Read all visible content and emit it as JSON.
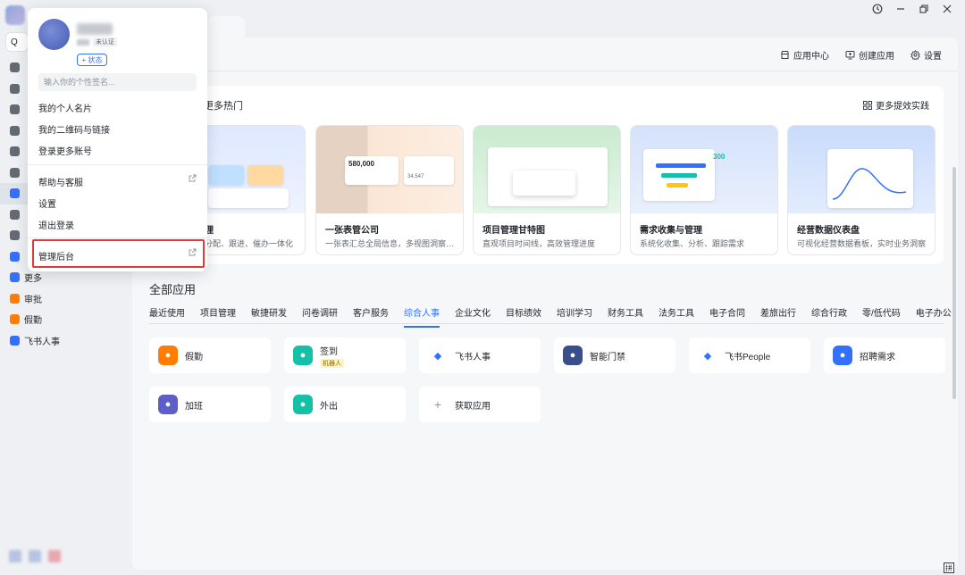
{
  "window": {
    "history_icon": "history-icon",
    "min_icon": "minimize-icon",
    "max_icon": "restore-icon",
    "close_icon": "close-icon"
  },
  "nav": {
    "search_label": "Q",
    "items": [
      {
        "label": "",
        "icon": "chat-icon",
        "color": "#646a73"
      },
      {
        "label": "",
        "icon": "video-icon",
        "color": "#646a73"
      },
      {
        "label": "",
        "icon": "calendar-icon",
        "color": "#646a73"
      },
      {
        "label": "",
        "icon": "cloud-doc-icon",
        "color": "#646a73"
      },
      {
        "label": "",
        "icon": "task-icon",
        "color": "#646a73"
      },
      {
        "label": "",
        "icon": "book-icon",
        "color": "#646a73"
      },
      {
        "label": "",
        "icon": "workbench-icon",
        "color": "#3370ff",
        "active": true
      },
      {
        "label": "",
        "icon": "approve-icon",
        "color": "#646a73"
      },
      {
        "label": "",
        "icon": "contacts-icon",
        "color": "#646a73"
      },
      {
        "label": "",
        "icon": "diamond-icon",
        "color": "#3370ff"
      },
      {
        "label": "更多",
        "icon": "more-apps-icon",
        "color": "#3370ff"
      },
      {
        "label": "审批",
        "icon": "approval-icon",
        "color": "#ff7d00"
      },
      {
        "label": "假勤",
        "icon": "leave-icon",
        "color": "#ff7d00"
      },
      {
        "label": "飞书人事",
        "icon": "feishu-hr-icon",
        "color": "#3370ff"
      }
    ]
  },
  "header": {
    "app_center": "应用中心",
    "create_app": "创建应用",
    "settings": "设置"
  },
  "hot": {
    "title": "更多热门",
    "more_link": "更多提效实践",
    "templates": [
      {
        "name": "理",
        "desc": "分配、跟进、催办一体化"
      },
      {
        "name": "一张表管公司",
        "desc": "一张表汇总全局信息，多视图洞察…",
        "thumb_value": "580,000",
        "thumb_small": "34,547"
      },
      {
        "name": "项目管理甘特图",
        "desc": "直观项目时间线，高效管理进度"
      },
      {
        "name": "需求收集与管理",
        "desc": "系统化收集、分析、跟踪需求",
        "thumb_value": "300"
      },
      {
        "name": "经营数据仪表盘",
        "desc": "可视化经营数据看板，实时业务洞察"
      }
    ]
  },
  "all_apps": {
    "title": "全部应用",
    "categories": [
      "最近使用",
      "项目管理",
      "敏捷研发",
      "问卷调研",
      "客户服务",
      "综合人事",
      "企业文化",
      "目标绩效",
      "培训学习",
      "财务工具",
      "法务工具",
      "电子合同",
      "差旅出行",
      "综合行政",
      "零/低代码",
      "电子办公"
    ],
    "active_category": "综合人事",
    "apps": [
      {
        "label": "假勤",
        "icon": "leave-icon",
        "color": "#ff7d00"
      },
      {
        "label": "签到",
        "sub": "机器人",
        "icon": "checkin-icon",
        "color": "#14c0a6"
      },
      {
        "label": "飞书人事",
        "icon": "feishu-hr-icon",
        "color": "#ffffff"
      },
      {
        "label": "智能门禁",
        "icon": "door-icon",
        "color": "#3b4e8c"
      },
      {
        "label": "飞书People",
        "icon": "people-icon",
        "color": "#ffffff"
      },
      {
        "label": "招聘需求",
        "icon": "recruit-icon",
        "color": "#3370ff"
      },
      {
        "label": "加班",
        "icon": "overtime-icon",
        "color": "#5b5fc7"
      },
      {
        "label": "外出",
        "icon": "outing-icon",
        "color": "#14c0a6"
      },
      {
        "label": "获取应用",
        "icon": "plus-icon",
        "color": "#ffffff"
      }
    ]
  },
  "popup": {
    "status_button": "+ 状态",
    "verified_badge": "未认证",
    "signature_placeholder": "输入你的个性签名...",
    "menu": [
      "我的个人名片",
      "我的二维码与链接",
      "登录更多账号",
      "帮助与客服",
      "设置",
      "退出登录",
      "管理后台"
    ]
  },
  "bottom_ime": "拼"
}
